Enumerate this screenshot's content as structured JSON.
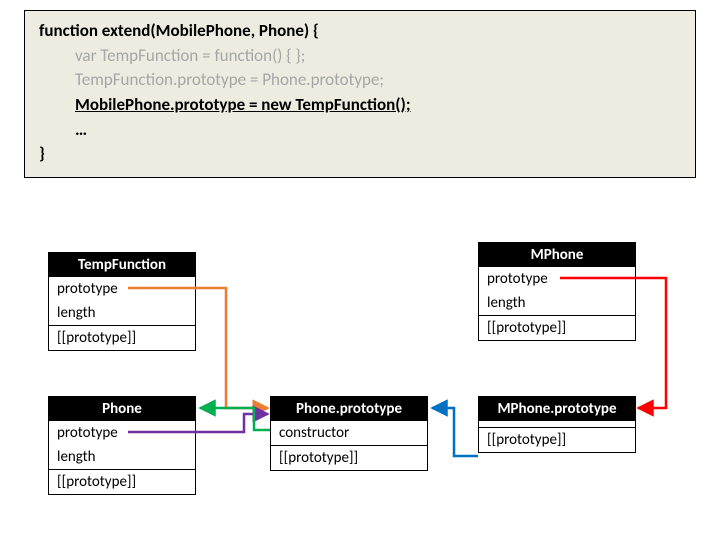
{
  "code": {
    "sig": "function extend(MobilePhone, Phone) {",
    "l1": "var TempFunction = function() { };",
    "l2": "TempFunction.prototype = Phone.prototype;",
    "l3": "MobilePhone.prototype = new TempFunction();",
    "dots": "…",
    "close": "}"
  },
  "boxes": {
    "tempfn": {
      "title": "TempFunction",
      "r1": "prototype",
      "r2": "length",
      "r3": "[[prototype]]"
    },
    "mphone": {
      "title": "MPhone",
      "r1": "prototype",
      "r2": "length",
      "r3": "[[prototype]]"
    },
    "phone": {
      "title": "Phone",
      "r1": "prototype",
      "r2": "length",
      "r3": "[[prototype]]"
    },
    "phoneproto": {
      "title": "Phone.prototype",
      "r1": "constructor",
      "r2": "[[prototype]]"
    },
    "mphoneproto": {
      "title": "MPhone.prototype",
      "r1": " ",
      "r2": "[[prototype]]"
    }
  },
  "chart_data": {
    "type": "diagram",
    "nodes": [
      {
        "id": "TempFunction",
        "fields": [
          "prototype",
          "length",
          "[[prototype]]"
        ]
      },
      {
        "id": "MPhone",
        "fields": [
          "prototype",
          "length",
          "[[prototype]]"
        ]
      },
      {
        "id": "Phone",
        "fields": [
          "prototype",
          "length",
          "[[prototype]]"
        ]
      },
      {
        "id": "Phone.prototype",
        "fields": [
          "constructor",
          "[[prototype]]"
        ]
      },
      {
        "id": "MPhone.prototype",
        "fields": [
          "",
          "[[prototype]]"
        ]
      }
    ],
    "edges": [
      {
        "from": "TempFunction.prototype",
        "to": "Phone.prototype",
        "color": "#ed7d31"
      },
      {
        "from": "Phone.prototype",
        "to": "Phone.prototype",
        "color": "#7030a0",
        "note": "Phone → Phone.prototype"
      },
      {
        "from": "Phone.prototype.constructor",
        "to": "Phone",
        "color": "#00b050"
      },
      {
        "from": "MPhone.prototype",
        "to": "MPhone.prototype",
        "color": "#ff0000",
        "note": "MPhone → MPhone.prototype"
      },
      {
        "from": "MPhone.prototype.[[prototype]]",
        "to": "Phone.prototype",
        "color": "#0070c0"
      }
    ]
  }
}
